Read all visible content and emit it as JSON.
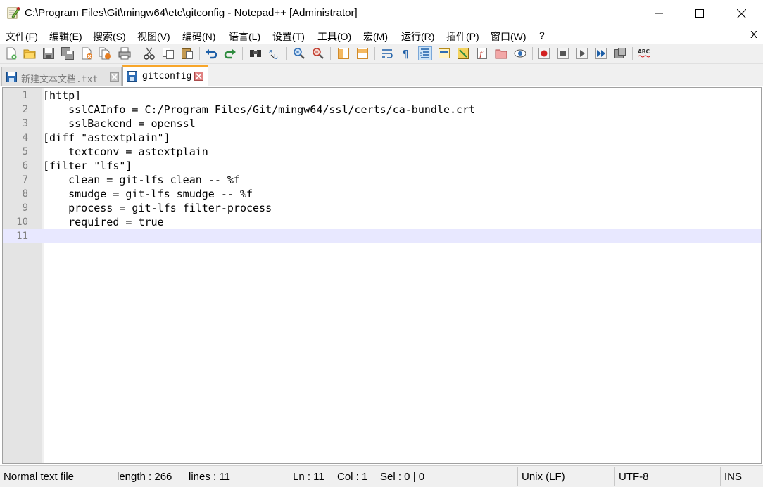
{
  "window": {
    "title": "C:\\Program Files\\Git\\mingw64\\etc\\gitconfig - Notepad++ [Administrator]"
  },
  "menu": {
    "items": [
      "文件(F)",
      "编辑(E)",
      "搜索(S)",
      "视图(V)",
      "编码(N)",
      "语言(L)",
      "设置(T)",
      "工具(O)",
      "宏(M)",
      "运行(R)",
      "插件(P)",
      "窗口(W)",
      "?"
    ],
    "close_label": "X"
  },
  "tabs": [
    {
      "label": "新建文本文档.txt",
      "active": false
    },
    {
      "label": "gitconfig",
      "active": true
    }
  ],
  "editor": {
    "lines": [
      {
        "num": "1",
        "text": "[http]"
      },
      {
        "num": "2",
        "text": "    sslCAInfo = C:/Program Files/Git/mingw64/ssl/certs/ca-bundle.crt"
      },
      {
        "num": "3",
        "text": "    sslBackend = openssl"
      },
      {
        "num": "4",
        "text": "[diff \"astextplain\"]"
      },
      {
        "num": "5",
        "text": "    textconv = astextplain"
      },
      {
        "num": "6",
        "text": "[filter \"lfs\"]"
      },
      {
        "num": "7",
        "text": "    clean = git-lfs clean -- %f"
      },
      {
        "num": "8",
        "text": "    smudge = git-lfs smudge -- %f"
      },
      {
        "num": "9",
        "text": "    process = git-lfs filter-process"
      },
      {
        "num": "10",
        "text": "    required = true"
      },
      {
        "num": "11",
        "text": ""
      }
    ],
    "current_line": 11
  },
  "status": {
    "file_type": "Normal text file",
    "length": "length : 266",
    "lines": "lines : 11",
    "ln": "Ln : 11",
    "col": "Col : 1",
    "sel": "Sel : 0 | 0",
    "eol": "Unix (LF)",
    "encoding": "UTF-8",
    "mode": "INS"
  },
  "colors": {
    "current_line": "#e8e8ff",
    "gutter": "#e4e4e4",
    "active_tab_accent": "#f8a62a",
    "line_number": "#808080"
  }
}
